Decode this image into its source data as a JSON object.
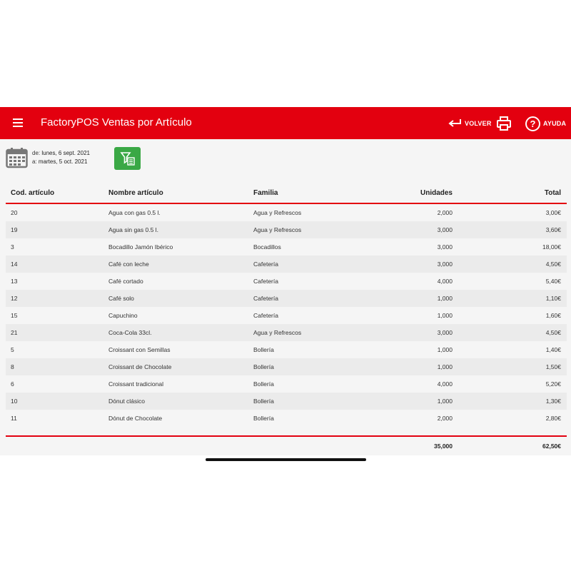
{
  "header": {
    "title": "FactoryPOS Ventas por Artículo",
    "back_label": "VOLVER",
    "help_label": "AYUDA"
  },
  "daterange": {
    "from_prefix": "de:",
    "from_value": "lunes, 6 sept. 2021",
    "to_prefix": "a:",
    "to_value": "martes, 5 oct. 2021"
  },
  "table": {
    "columns": [
      "Cod. artículo",
      "Nombre artículo",
      "Familia",
      "Unidades",
      "Total"
    ],
    "rows": [
      [
        "20",
        "Agua con gas 0.5 l.",
        "Agua y Refrescos",
        "2,000",
        "3,00€"
      ],
      [
        "19",
        "Agua sin gas 0.5 l.",
        "Agua y Refrescos",
        "3,000",
        "3,60€"
      ],
      [
        "3",
        "Bocadillo Jamón Ibérico",
        "Bocadillos",
        "3,000",
        "18,00€"
      ],
      [
        "14",
        "Café con leche",
        "Cafetería",
        "3,000",
        "4,50€"
      ],
      [
        "13",
        "Café cortado",
        "Cafetería",
        "4,000",
        "5,40€"
      ],
      [
        "12",
        "Café solo",
        "Cafetería",
        "1,000",
        "1,10€"
      ],
      [
        "15",
        "Capuchino",
        "Cafetería",
        "1,000",
        "1,60€"
      ],
      [
        "21",
        "Coca-Cola 33cl.",
        "Agua y Refrescos",
        "3,000",
        "4,50€"
      ],
      [
        "5",
        "Croissant con Semillas",
        "Bollería",
        "1,000",
        "1,40€"
      ],
      [
        "8",
        "Croissant de Chocolate",
        "Bollería",
        "1,000",
        "1,50€"
      ],
      [
        "6",
        "Croissant tradicional",
        "Bollería",
        "4,000",
        "5,20€"
      ],
      [
        "10",
        "Dónut clásico",
        "Bollería",
        "1,000",
        "1,30€"
      ],
      [
        "11",
        "Dónut de Chocolate",
        "Bollería",
        "2,000",
        "2,80€"
      ]
    ],
    "totals": {
      "units": "35,000",
      "total": "62,50€"
    }
  },
  "colors": {
    "accent": "#e3000f",
    "filter": "#3aa845"
  }
}
